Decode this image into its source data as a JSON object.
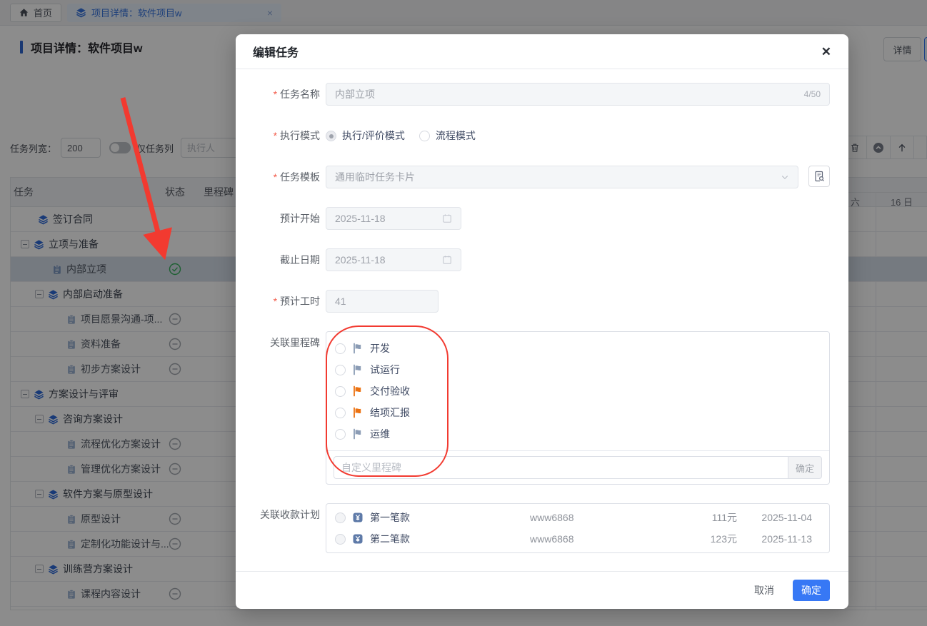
{
  "colors": {
    "primary": "#3778f5",
    "annotation_red": "#f23a30",
    "flag_gray": "#8b9cb5",
    "flag_orange": "#ec7211",
    "done_green": "#36b05c",
    "pending_gray": "#a3a8b0",
    "tree_blue": "#2f6bd9"
  },
  "tabs": {
    "home": "首页",
    "active": "项目详情：软件项目w"
  },
  "page": {
    "title": "项目详情：软件项目w",
    "detail_button": "详情"
  },
  "controls": {
    "col_width_label": "任务列宽：",
    "col_width_value": "200",
    "only_task_label": "仅任务列",
    "executor_placeholder": "执行人"
  },
  "table": {
    "headers": [
      "任务",
      "状态",
      "里程碑"
    ],
    "gantt": {
      "week": "六",
      "day": "16 日"
    },
    "rows": [
      {
        "label": "签订合同",
        "level": 0,
        "kind": "group",
        "expander": false,
        "status": null,
        "selected": false
      },
      {
        "label": "立项与准备",
        "level": 0,
        "kind": "group",
        "expander": true,
        "status": null,
        "selected": false
      },
      {
        "label": "内部立项",
        "level": 1,
        "kind": "task",
        "expander": false,
        "status": "done",
        "selected": true
      },
      {
        "label": "内部启动准备",
        "level": 1,
        "kind": "group",
        "expander": true,
        "status": null,
        "selected": false
      },
      {
        "label": "项目愿景沟通-项...",
        "level": 2,
        "kind": "task",
        "expander": false,
        "status": "pending",
        "selected": false
      },
      {
        "label": "资料准备",
        "level": 2,
        "kind": "task",
        "expander": false,
        "status": "pending",
        "selected": false
      },
      {
        "label": "初步方案设计",
        "level": 2,
        "kind": "task",
        "expander": false,
        "status": "pending",
        "selected": false
      },
      {
        "label": "方案设计与评审",
        "level": 0,
        "kind": "group",
        "expander": true,
        "status": null,
        "selected": false
      },
      {
        "label": "咨询方案设计",
        "level": 1,
        "kind": "group",
        "expander": true,
        "status": null,
        "selected": false
      },
      {
        "label": "流程优化方案设计",
        "level": 2,
        "kind": "task",
        "expander": false,
        "status": "pending",
        "selected": false
      },
      {
        "label": "管理优化方案设计",
        "level": 2,
        "kind": "task",
        "expander": false,
        "status": "pending",
        "selected": false
      },
      {
        "label": "软件方案与原型设计",
        "level": 1,
        "kind": "group",
        "expander": true,
        "status": null,
        "selected": false
      },
      {
        "label": "原型设计",
        "level": 2,
        "kind": "task",
        "expander": false,
        "status": "pending",
        "selected": false
      },
      {
        "label": "定制化功能设计与...",
        "level": 2,
        "kind": "task",
        "expander": false,
        "status": "pending",
        "selected": false
      },
      {
        "label": "训练营方案设计",
        "level": 1,
        "kind": "group",
        "expander": true,
        "status": null,
        "selected": false
      },
      {
        "label": "课程内容设计",
        "level": 2,
        "kind": "task",
        "expander": false,
        "status": "pending",
        "selected": false
      }
    ]
  },
  "modal": {
    "title": "编辑任务",
    "name": {
      "label": "任务名称",
      "value": "内部立项",
      "counter": "4/50"
    },
    "exec": {
      "label": "执行模式",
      "options": [
        "执行/评价模式",
        "流程模式"
      ],
      "selected": "执行/评价模式"
    },
    "template": {
      "label": "任务模板",
      "value": "通用临时任务卡片"
    },
    "start": {
      "label": "预计开始",
      "value": "2025-11-18"
    },
    "deadline": {
      "label": "截止日期",
      "value": "2025-11-18"
    },
    "hours": {
      "label": "预计工时",
      "value": "41"
    },
    "milestones": {
      "label": "关联里程碑",
      "options": [
        {
          "name": "开发",
          "flag": "gray"
        },
        {
          "name": "试运行",
          "flag": "gray"
        },
        {
          "name": "交付验收",
          "flag": "orange"
        },
        {
          "name": "结项汇报",
          "flag": "orange"
        },
        {
          "name": "运维",
          "flag": "gray"
        }
      ],
      "custom_placeholder": "自定义里程碑",
      "confirm_label": "确定"
    },
    "payments": {
      "label": "关联收款计划",
      "rows": [
        {
          "name": "第一笔款",
          "code": "www6868",
          "amount": "111元",
          "date": "2025-11-04"
        },
        {
          "name": "第二笔款",
          "code": "www6868",
          "amount": "123元",
          "date": "2025-11-13"
        }
      ]
    },
    "footer": {
      "cancel": "取消",
      "confirm": "确定"
    }
  }
}
